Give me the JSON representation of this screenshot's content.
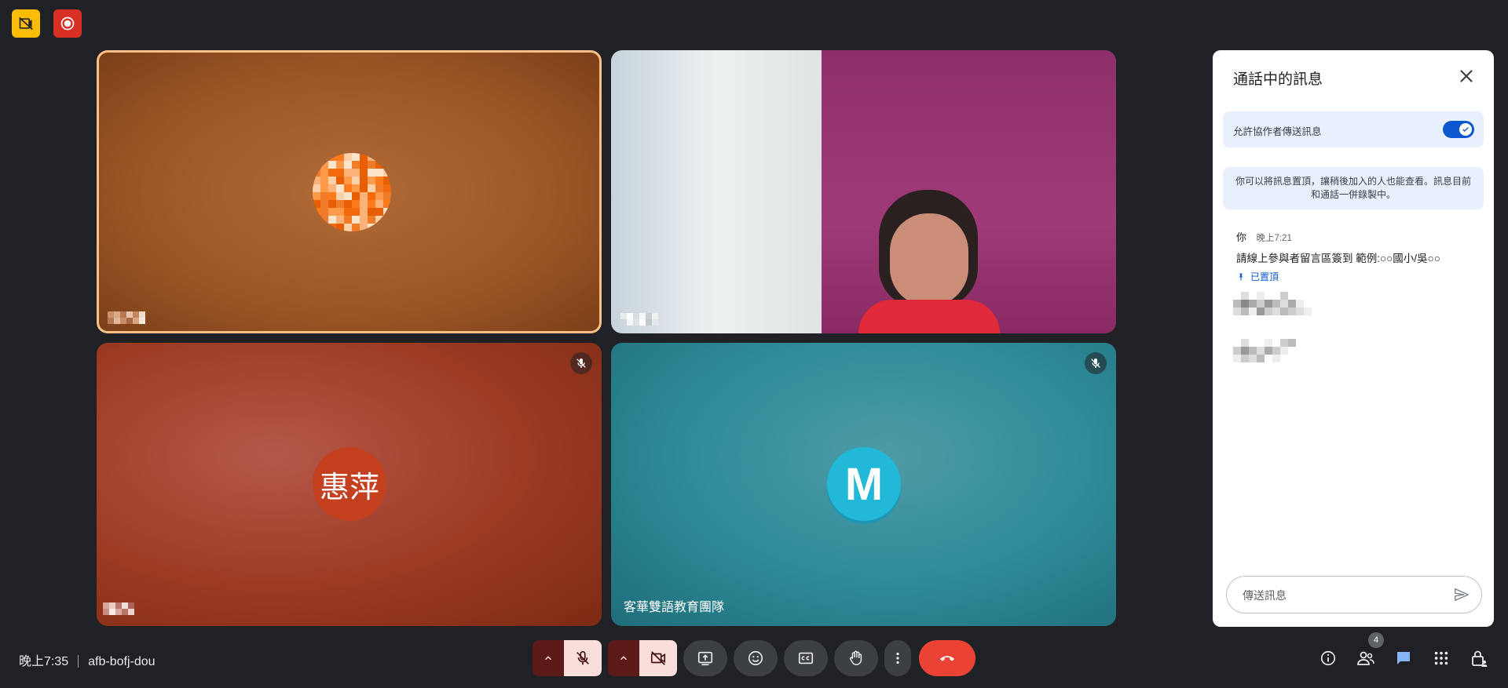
{
  "top": {
    "icons": [
      "no-record-icon",
      "recording-icon"
    ]
  },
  "tiles": [
    {
      "id": "tile-1",
      "label": "",
      "speaking": true,
      "muted": false,
      "color": "#a65b2a"
    },
    {
      "id": "tile-2",
      "label": "",
      "speaking": false,
      "muted": false,
      "type": "video"
    },
    {
      "id": "tile-3",
      "label": "",
      "avatar_text": "惠萍",
      "muted": true,
      "color": "#9c3a22"
    },
    {
      "id": "tile-4",
      "label": "客華雙語教育團隊",
      "avatar_text": "M",
      "muted": true,
      "color": "#2f8c9a"
    }
  ],
  "panel": {
    "title": "通話中的訊息",
    "allow_label": "允許協作者傳送訊息",
    "allow_enabled": true,
    "info_text": "你可以將訊息置頂，讓稍後加入的人也能查看。訊息目前和通話一併錄製中。",
    "message": {
      "sender": "你",
      "time": "晚上7:21",
      "text": "請線上參與者留言區簽到 範例:○○國小/吳○○",
      "pinned_label": "已置頂"
    },
    "input_placeholder": "傳送訊息"
  },
  "bottom": {
    "time": "晚上7:35",
    "meeting_code": "afb-bofj-dou",
    "participant_count": "4"
  },
  "colors": {
    "accent": "#0b57d0",
    "end_call": "#ea4335",
    "muted_bg": "#f9dedc",
    "muted_dark": "#5c1a19"
  }
}
